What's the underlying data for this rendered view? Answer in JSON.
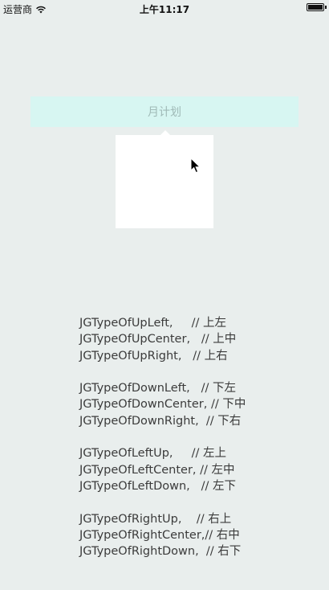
{
  "status_bar": {
    "carrier": "运营商",
    "time": "上午11:17"
  },
  "button": {
    "label": "月计划"
  },
  "type_groups": [
    [
      {
        "code": "JGTypeOfUpLeft,",
        "gap": "     ",
        "comment": "// 上左"
      },
      {
        "code": "JGTypeOfUpCenter,",
        "gap": "   ",
        "comment": "// 上中"
      },
      {
        "code": "JGTypeOfUpRight,",
        "gap": "   ",
        "comment": "// 上右"
      }
    ],
    [
      {
        "code": "JGTypeOfDownLeft,",
        "gap": "   ",
        "comment": "// 下左"
      },
      {
        "code": "JGTypeOfDownCenter,",
        "gap": " ",
        "comment": "// 下中"
      },
      {
        "code": "JGTypeOfDownRight,",
        "gap": "  ",
        "comment": "// 下右"
      }
    ],
    [
      {
        "code": "JGTypeOfLeftUp,",
        "gap": "     ",
        "comment": "// 左上"
      },
      {
        "code": "JGTypeOfLeftCenter,",
        "gap": " ",
        "comment": "// 左中"
      },
      {
        "code": "JGTypeOfLeftDown,",
        "gap": "   ",
        "comment": "// 左下"
      }
    ],
    [
      {
        "code": "JGTypeOfRightUp,",
        "gap": "    ",
        "comment": "// 右上"
      },
      {
        "code": "JGTypeOfRightCenter,",
        "gap": "",
        "comment": "// 右中"
      },
      {
        "code": "JGTypeOfRightDown,",
        "gap": "  ",
        "comment": "// 右下"
      }
    ]
  ],
  "icons": {
    "wifi": "wifi-icon",
    "battery": "battery-icon",
    "cursor": "mouse-cursor-icon"
  },
  "colors": {
    "background": "#e9eeed",
    "button_background": "#d7f6f2",
    "button_text": "#9fb9b6",
    "popover": "#ffffff"
  }
}
